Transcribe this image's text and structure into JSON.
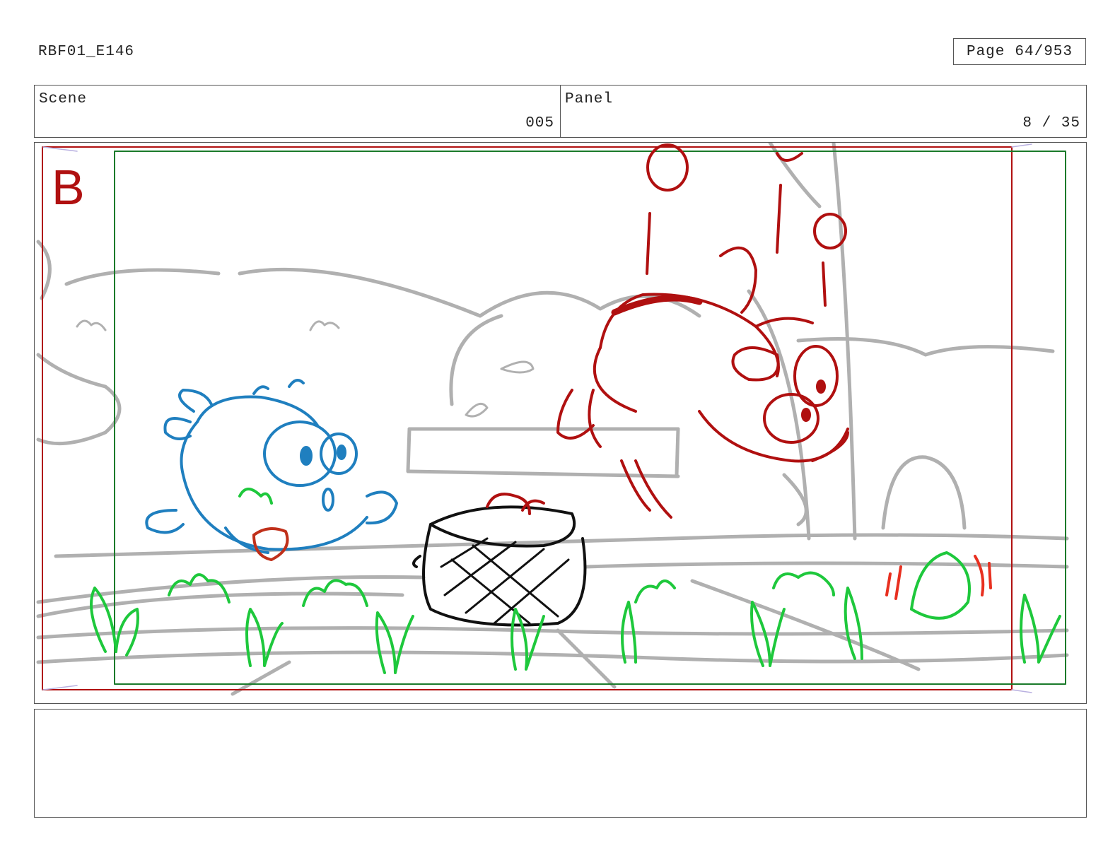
{
  "header": {
    "doc_id": "RBF01_E146",
    "page_label": "Page",
    "page_value": "64/953"
  },
  "info": {
    "scene_label": "Scene",
    "scene_value": "005",
    "panel_label": "Panel",
    "panel_value": "8 / 35"
  },
  "panel": {
    "letter": "B",
    "colors": {
      "safe_frame": "#b01010",
      "action_frame": "#1a7a2a",
      "background_lines": "#b0b0b0",
      "blue_character": "#1f7fbf",
      "red_character": "#b01010",
      "plants": "#1ec83c",
      "basket": "#111111"
    }
  },
  "notes": {
    "text": ""
  }
}
